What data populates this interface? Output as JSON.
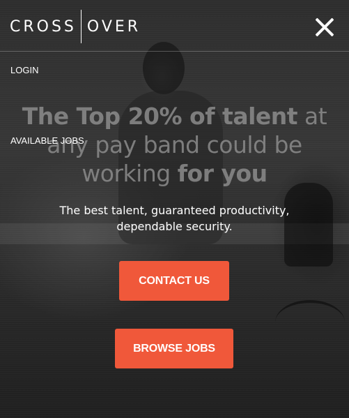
{
  "brand": {
    "logo_left": "CROSS",
    "logo_right": "OVER",
    "accent_color": "#f0583a"
  },
  "menu": {
    "close_icon": "close-icon",
    "items": [
      {
        "label": "LOGIN"
      },
      {
        "label": "AVAILABLE JOBS"
      }
    ]
  },
  "hero": {
    "headline_part1": "The Top 20% of talent",
    "headline_part2": " at any pay band could be working ",
    "headline_part3": "for you",
    "subhead": "The best talent, guaranteed productivity, dependable security.",
    "buttons": {
      "contact_label": "CONTACT US",
      "browse_label": "BROWSE JOBS"
    }
  }
}
